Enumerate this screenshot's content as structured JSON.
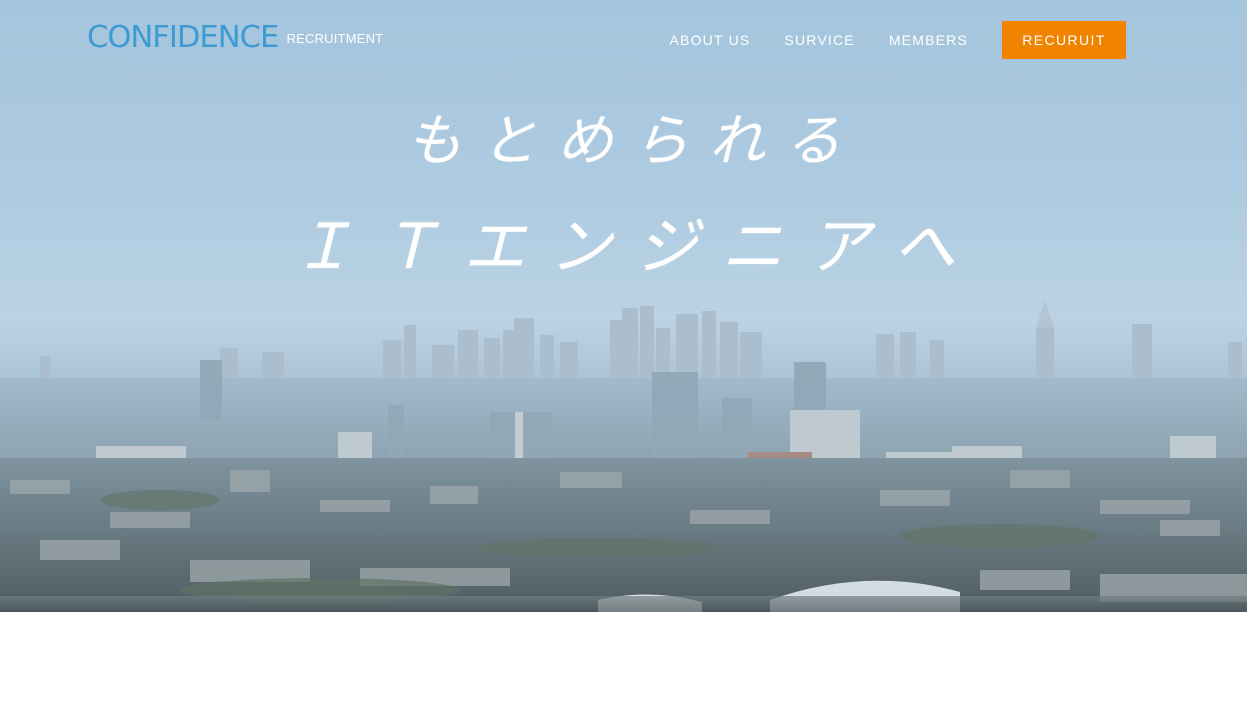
{
  "header": {
    "logo_main": "CONFIDENCE",
    "logo_sub": "RECRUITMENT"
  },
  "nav": {
    "items": [
      {
        "label": "ABOUT US"
      },
      {
        "label": "SURVICE"
      },
      {
        "label": "MEMBERS"
      }
    ],
    "cta_label": "RECURUIT"
  },
  "hero": {
    "catch_line1": "もとめられる",
    "catch_line2": "ＩＴエンジニアへ"
  },
  "colors": {
    "logo": "#3d9bd3",
    "cta": "#f08300",
    "nav_text": "#ffffff"
  }
}
